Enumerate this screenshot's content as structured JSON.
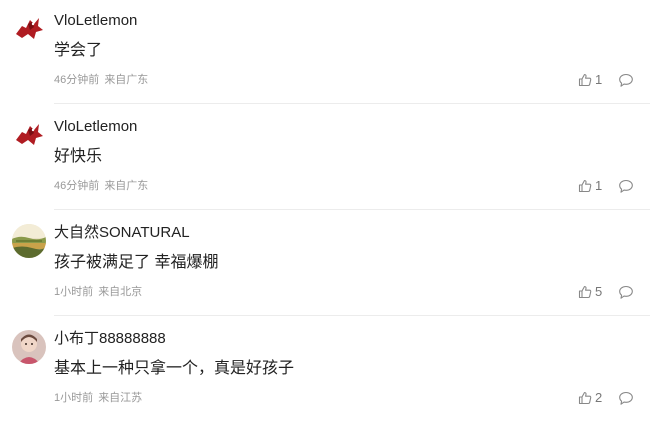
{
  "comments": [
    {
      "username": "VloLetlemon",
      "avatar_icon": "red-bird-avatar",
      "content": "学会了",
      "time": "46分钟前",
      "location": "来自广东",
      "likes": "1"
    },
    {
      "username": "VloLetlemon",
      "avatar_icon": "red-bird-avatar",
      "content": "好快乐",
      "time": "46分钟前",
      "location": "来自广东",
      "likes": "1"
    },
    {
      "username": "大自然SONATURAL",
      "avatar_icon": "landscape-avatar",
      "content": "孩子被满足了 幸福爆棚",
      "time": "1小时前",
      "location": "来自北京",
      "likes": "5"
    },
    {
      "username": "小布丁88888888",
      "avatar_icon": "child-photo-avatar",
      "content": "基本上一种只拿一个，真是好孩子",
      "time": "1小时前",
      "location": "来自江苏",
      "likes": "2"
    }
  ],
  "colors": {
    "text_primary": "#222222",
    "text_meta": "#999999",
    "icon": "#888888",
    "divider": "#ececec"
  }
}
